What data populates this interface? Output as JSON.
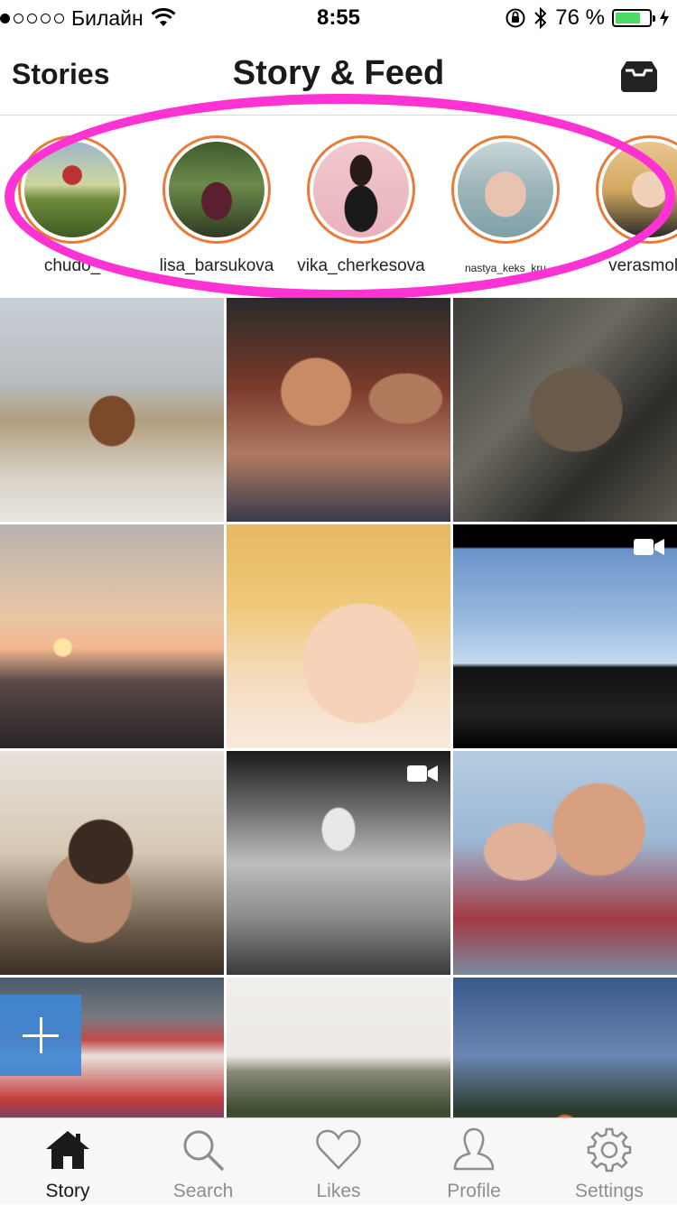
{
  "status_bar": {
    "carrier": "Билайн",
    "time": "8:55",
    "battery": "76 %",
    "battery_level": 0.76,
    "signal_bars": 1
  },
  "nav": {
    "left_label": "Stories",
    "title": "Story & Feed",
    "inbox_icon": "inbox-icon"
  },
  "stories": [
    {
      "username": "chudo_"
    },
    {
      "username": "lisa_barsukova"
    },
    {
      "username": "vika_cherkesova"
    },
    {
      "username": "nastya_keks_kru"
    },
    {
      "username": "verasmolin"
    }
  ],
  "grid": {
    "video_icon": "video-camera-icon",
    "add_icon": "plus-icon"
  },
  "tabs": [
    {
      "label": "Story",
      "icon": "home-icon",
      "active": true
    },
    {
      "label": "Search",
      "icon": "search-icon",
      "active": false
    },
    {
      "label": "Likes",
      "icon": "heart-icon",
      "active": false
    },
    {
      "label": "Profile",
      "icon": "person-icon",
      "active": false
    },
    {
      "label": "Settings",
      "icon": "gear-icon",
      "active": false
    }
  ],
  "colors": {
    "story_ring": "#e97a3a",
    "highlight": "#ff33d4",
    "fab": "#3e87d2",
    "battery": "#4cd964"
  }
}
